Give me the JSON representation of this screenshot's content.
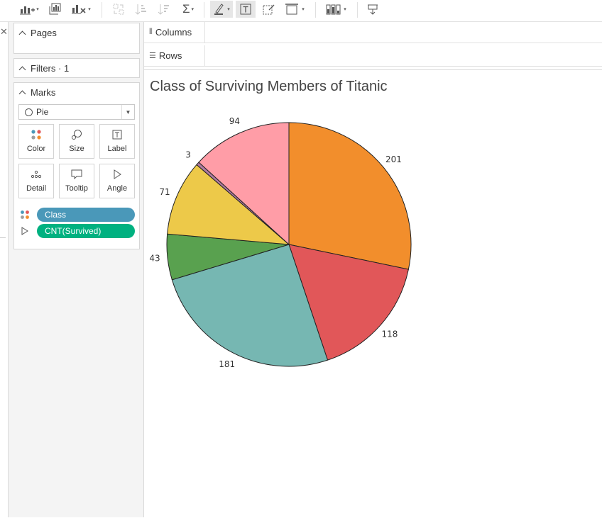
{
  "panels": {
    "pages": "Pages",
    "filters": "Filters · 1",
    "marks": "Marks",
    "mark_type": "Pie"
  },
  "mark_buttons": [
    "Color",
    "Size",
    "Label",
    "Detail",
    "Tooltip",
    "Angle"
  ],
  "pills": {
    "color": {
      "label": "Class",
      "color": "#4a98b9"
    },
    "angle": {
      "label": "CNT(Survived)",
      "color": "#00b180"
    }
  },
  "shelves": {
    "columns": "Columns",
    "rows": "Rows"
  },
  "icons": {
    "toolbar": [
      "new-worksheet-icon",
      "duplicate-sheet-icon",
      "clear-sheet-icon",
      "swap-icon",
      "sort-ascending-icon",
      "sort-descending-icon",
      "totals-icon",
      "highlight-icon",
      "show-mark-labels-icon",
      "fix-axes-icon",
      "fit-icon",
      "show-me-icon",
      "presentation-icon"
    ]
  },
  "chart_data": {
    "type": "pie",
    "title": "Class of Surviving Members of Titanic",
    "slices": [
      {
        "value": 201,
        "label": "201",
        "color": "#f28e2c"
      },
      {
        "value": 118,
        "label": "118",
        "color": "#e15759"
      },
      {
        "value": 181,
        "label": "181",
        "color": "#76b7b2"
      },
      {
        "value": 43,
        "label": "43",
        "color": "#59a14f"
      },
      {
        "value": 71,
        "label": "71",
        "color": "#edc949"
      },
      {
        "value": 3,
        "label": "3",
        "color": "#af7aa1"
      },
      {
        "value": 94,
        "label": "94",
        "color": "#ff9da7"
      }
    ],
    "start": "12 o'clock",
    "direction": "clockwise"
  }
}
